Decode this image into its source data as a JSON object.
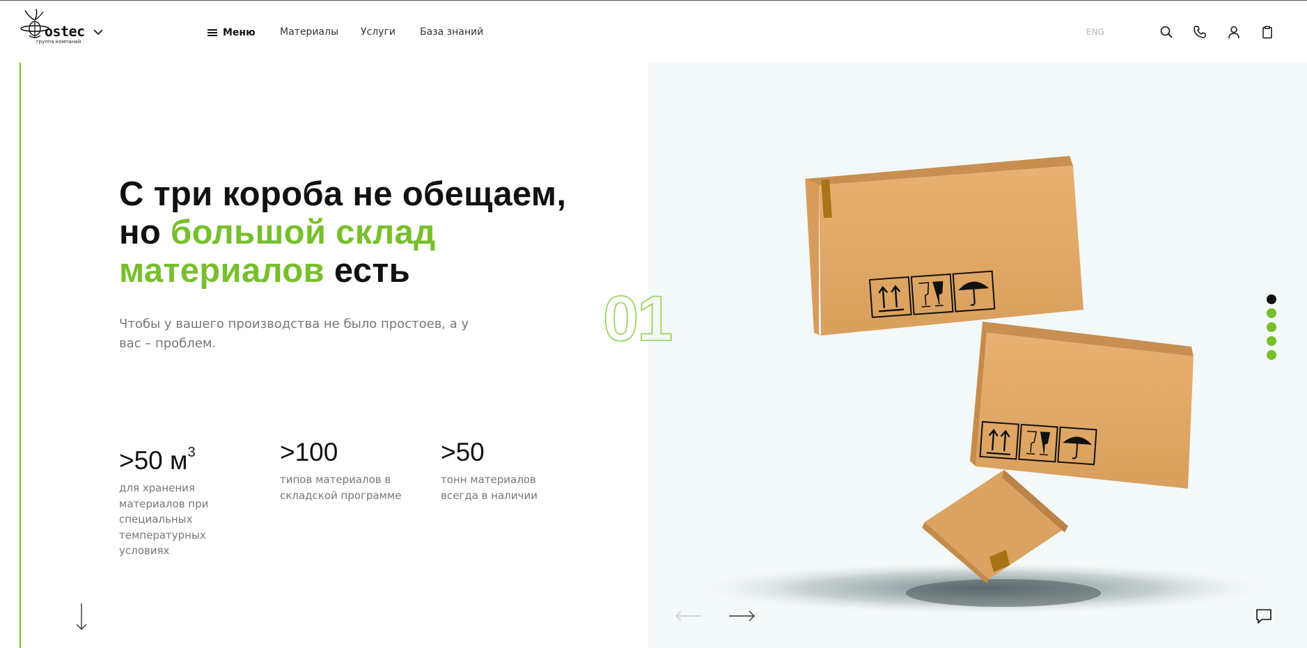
{
  "header": {
    "logo_text": "ostec",
    "logo_subtitle": "группа компаний",
    "menu_label": "Меню",
    "nav": [
      "Материалы",
      "Услуги",
      "База знаний"
    ],
    "lang": "ENG",
    "icons": [
      "search-icon",
      "phone-icon",
      "user-icon",
      "clipboard-icon"
    ]
  },
  "hero": {
    "headline_part1": "С три короба не обещаем,",
    "headline_part2": "но ",
    "headline_highlight1": "большой склад",
    "headline_highlight2": "материалов",
    "headline_part3": " есть",
    "subtitle": "Чтобы у вашего производства не было простоев, а у вас – проблем.",
    "stats": [
      {
        "value": ">50 м",
        "sup": "3",
        "desc": "для хранения материалов при специальных температурных условиях"
      },
      {
        "value": ">100",
        "sup": "",
        "desc": "типов материалов в складской программе"
      },
      {
        "value": ">50",
        "sup": "",
        "desc": "тонн материалов всегда в наличии"
      }
    ]
  },
  "slider": {
    "current_number": "01",
    "total_slides": 5,
    "active_index": 0
  },
  "colors": {
    "accent_green": "#77bf2c",
    "panel_bg": "#f3f8f8",
    "box": "#e3a968"
  }
}
